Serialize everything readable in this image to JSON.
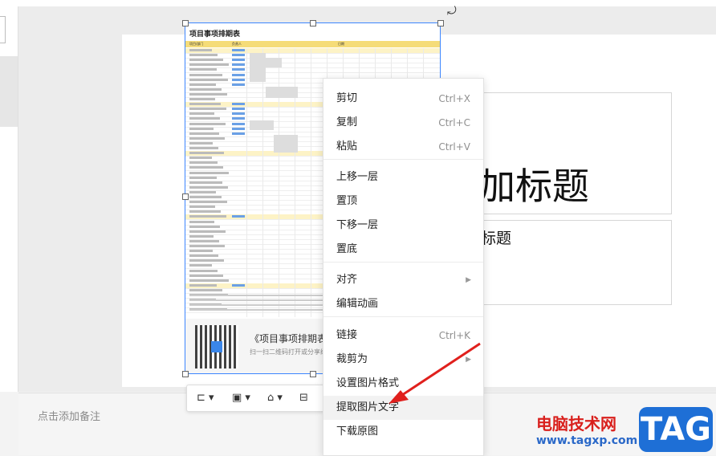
{
  "slide": {
    "title_placeholder": "加标题",
    "subtitle_placeholder": "标题",
    "notes_placeholder": "点击添加备注"
  },
  "image": {
    "sheet_title": "项目事项排期表",
    "head_col1": "项目/部门",
    "head_col2": "负责人",
    "head_col3": "日期",
    "caption": "《项目事项排期表》",
    "caption_sub": "扫一扫二维码打开或分享给",
    "qr_icon": "qr-code"
  },
  "image_toolbar": {
    "crop": "⊏",
    "image": "▣",
    "shape": "⌂",
    "align": "⊟"
  },
  "context_menu": {
    "items": [
      {
        "label": "剪切",
        "shortcut": "Ctrl+X"
      },
      {
        "label": "复制",
        "shortcut": "Ctrl+C"
      },
      {
        "label": "粘贴",
        "shortcut": "Ctrl+V"
      },
      {
        "label": "上移一层",
        "shortcut": ""
      },
      {
        "label": "置顶",
        "shortcut": ""
      },
      {
        "label": "下移一层",
        "shortcut": ""
      },
      {
        "label": "置底",
        "shortcut": ""
      },
      {
        "label": "对齐",
        "shortcut": "",
        "submenu": true
      },
      {
        "label": "编辑动画",
        "shortcut": ""
      },
      {
        "label": "链接",
        "shortcut": "Ctrl+K"
      },
      {
        "label": "裁剪为",
        "shortcut": "",
        "submenu": true
      },
      {
        "label": "设置图片格式",
        "shortcut": ""
      },
      {
        "label": "提取图片文字",
        "shortcut": "",
        "highlighted": true
      },
      {
        "label": "下载原图",
        "shortcut": ""
      }
    ]
  },
  "watermark": {
    "site_name": "电脑技术网",
    "site_url": "www.tagxp.com",
    "logo": "TAG"
  },
  "colors": {
    "selection": "#3d86ff",
    "arrow": "#e0201d",
    "header_fill": "#f5dc78"
  }
}
